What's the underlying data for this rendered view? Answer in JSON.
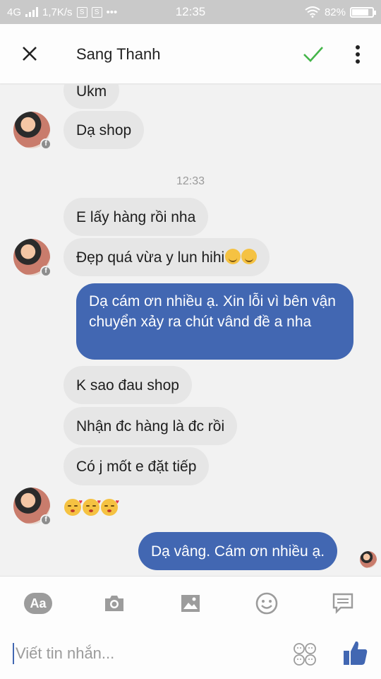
{
  "status_bar": {
    "network": "4G",
    "speed": "1,7K/s",
    "time": "12:35",
    "battery": "82%",
    "battery_level": 0.82
  },
  "header": {
    "contact_name": "Sang Thanh"
  },
  "chat": {
    "timestamp": "12:33",
    "messages": [
      {
        "text": "Ukm"
      },
      {
        "text": "Dạ shop"
      },
      {
        "text": "E lấy hàng rồi nha"
      },
      {
        "text": "Đẹp quá vừa y lun hihi"
      },
      {
        "text": "Dạ cám ơn nhiều ạ. Xin lỗi vì bên vận chuyển xảy ra chút vând đề a nha"
      },
      {
        "text": "K sao đau shop"
      },
      {
        "text": "Nhận đc hàng là đc rồi"
      },
      {
        "text": "Có j mốt e đặt tiếp"
      },
      {
        "text": "Dạ vâng. Cám ơn nhiều ạ."
      }
    ]
  },
  "composer": {
    "aa_label": "Aa",
    "placeholder": "Viết tin nhắn..."
  },
  "colors": {
    "accent": "#4267b2",
    "check": "#44b549"
  }
}
